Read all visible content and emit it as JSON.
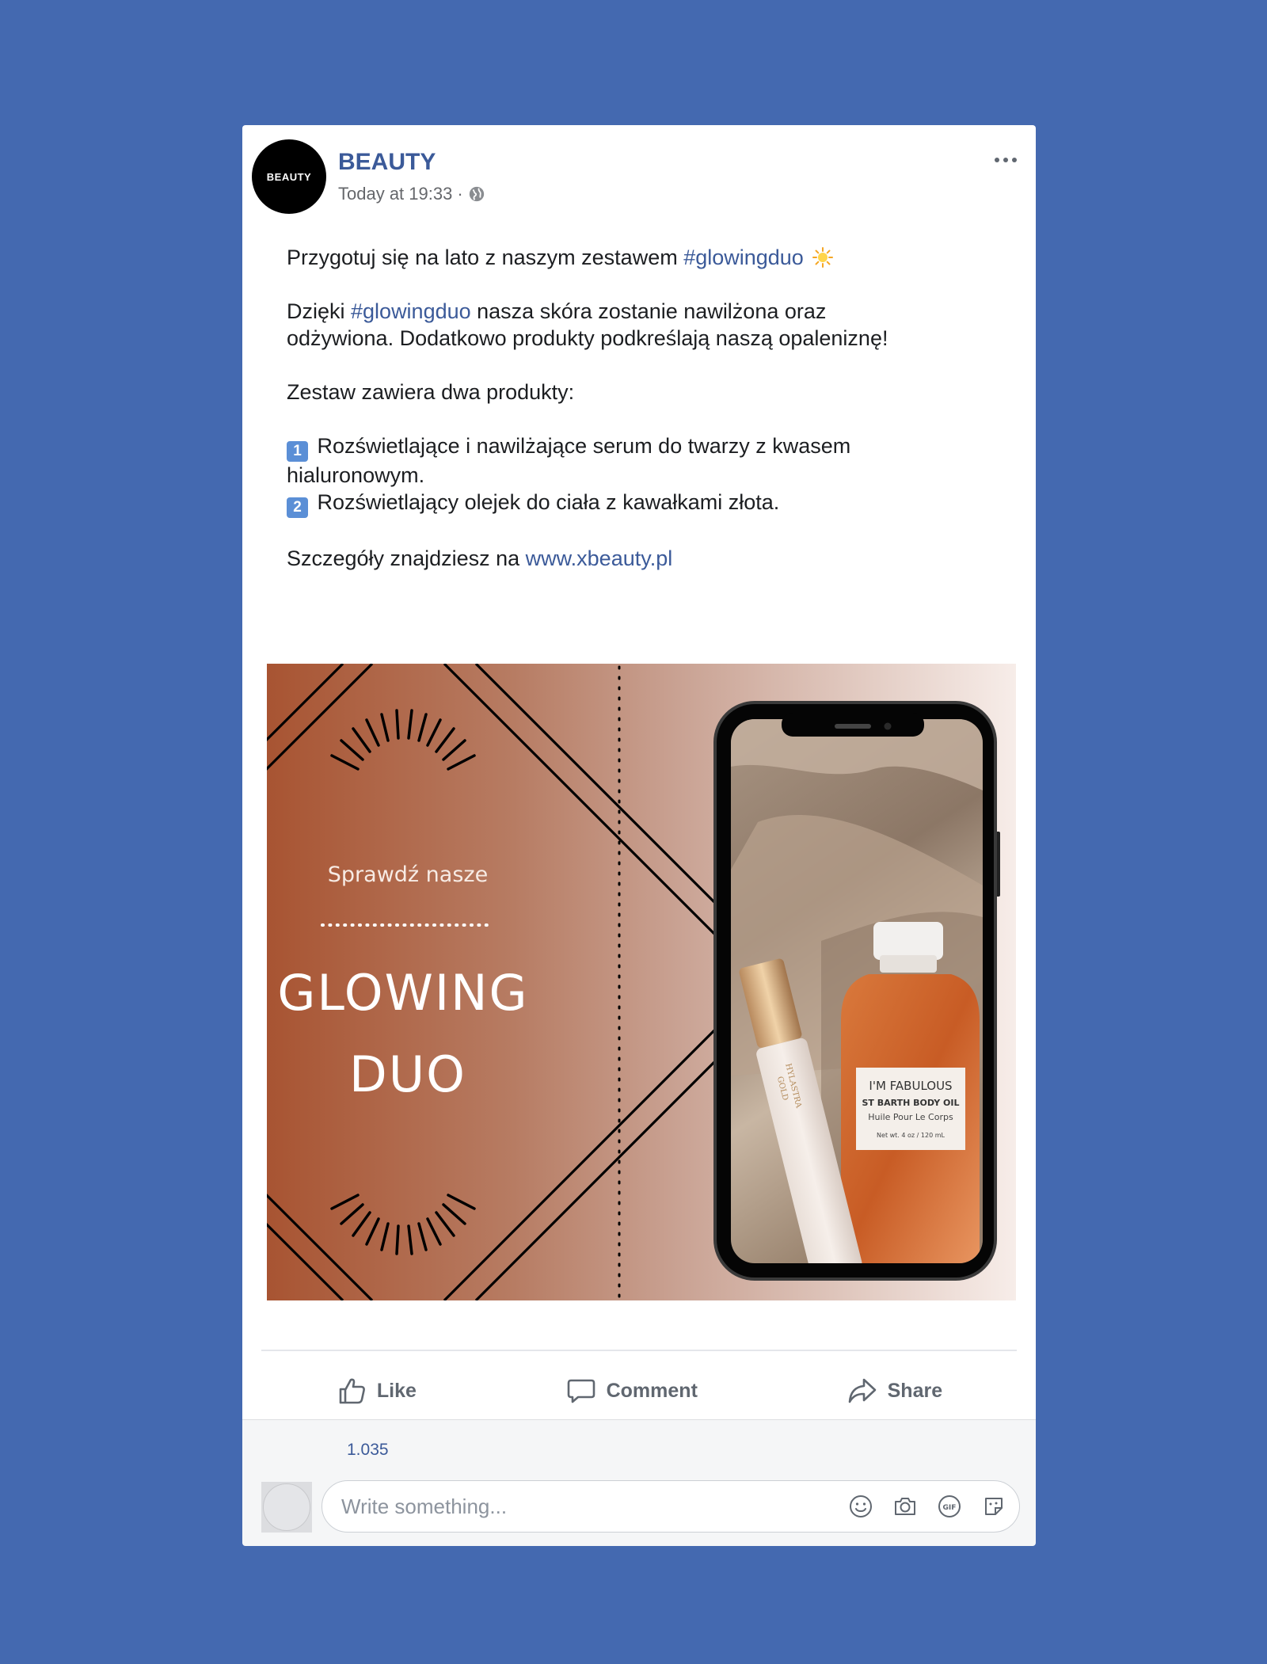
{
  "post": {
    "page_name": "BEAUTY",
    "avatar_text": "BEAUTY",
    "timestamp": "Today at 19:33",
    "separator": "·",
    "text": {
      "line1_pre": "Przygotuj się na lato z naszym zestawem ",
      "hashtag": "#glowingduo",
      "para2_pre": "Dzięki ",
      "para2_post": " nasza skóra zostanie nawilżona oraz odżywiona. Dodatkowo produkty podkreślają naszą opaleniznę!",
      "para3": "Zestaw zawiera dwa produkty:",
      "item1_key": "1",
      "item1": "Rozświetlające i nawilżające serum do twarzy z kwasem hialuronowym.",
      "item2_key": "2",
      "item2": "Rozświetlający olejek do ciała z kawałkami złota.",
      "details_pre": "Szczegóły znajdziesz na ",
      "link": "www.xbeauty.pl"
    },
    "image": {
      "subtitle": "Sprawdź nasze",
      "title_line1": "GLOWING",
      "title_line2": "DUO",
      "serum_brand_line1": "HYLASTRA",
      "serum_brand_line2": "GOLD",
      "oil_label_line1": "I'M FABULOUS",
      "oil_label_line2": "ST BARTH BODY OIL",
      "oil_label_line3": "Huile Pour Le Corps",
      "oil_label_line4": "Net wt. 4 oz / 120 mL"
    }
  },
  "actions": {
    "like": "Like",
    "comment": "Comment",
    "share": "Share"
  },
  "footer": {
    "like_count": "1.035",
    "comment_placeholder": "Write something..."
  },
  "colors": {
    "background": "#4469b0",
    "link": "#3b5a99",
    "gradient_start": "#a85432",
    "gradient_end": "#f7ede9"
  }
}
